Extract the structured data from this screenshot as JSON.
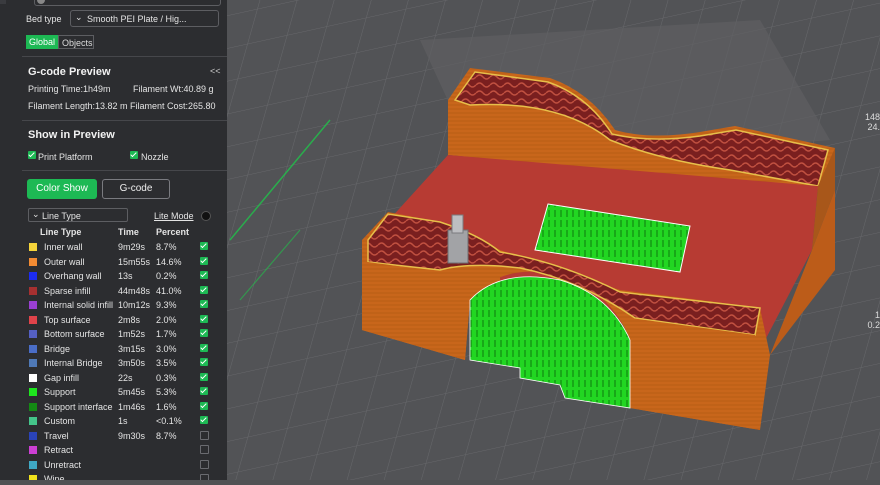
{
  "bed_type": {
    "label": "Bed type",
    "value": "Smooth PEI Plate / Hig..."
  },
  "tabs": {
    "global": "Global",
    "objects": "Objects"
  },
  "gcode_preview": {
    "title": "G-code Preview",
    "collapse": "<<",
    "printing_time": "Printing Time:1h49m",
    "filament_wt": "Filament Wt:40.89 g",
    "filament_length": "Filament Length:13.82 m",
    "filament_cost": "Filament Cost:265.80"
  },
  "show_in_preview": {
    "title": "Show in Preview",
    "print_platform": "Print Platform",
    "nozzle": "Nozzle"
  },
  "buttons": {
    "color_show": "Color Show",
    "gcode": "G-code"
  },
  "line_type_select": {
    "value": "Line Type",
    "lite_mode": "Lite Mode"
  },
  "table": {
    "headers": [
      "Line Type",
      "Time",
      "Percent"
    ],
    "rows": [
      {
        "label": "Inner wall",
        "time": "9m29s",
        "percent": "8.7%",
        "color": "#f5d43a",
        "checked": true
      },
      {
        "label": "Outer wall",
        "time": "15m55s",
        "percent": "14.6%",
        "color": "#f28b33",
        "checked": true
      },
      {
        "label": "Overhang wall",
        "time": "13s",
        "percent": "0.2%",
        "color": "#1c2cf0",
        "checked": true
      },
      {
        "label": "Sparse infill",
        "time": "44m48s",
        "percent": "41.0%",
        "color": "#a63030",
        "checked": true
      },
      {
        "label": "Internal solid infill",
        "time": "10m12s",
        "percent": "9.3%",
        "color": "#9a3fd1",
        "checked": true
      },
      {
        "label": "Top surface",
        "time": "2m8s",
        "percent": "2.0%",
        "color": "#e0434a",
        "checked": true
      },
      {
        "label": "Bottom surface",
        "time": "1m52s",
        "percent": "1.7%",
        "color": "#5560c4",
        "checked": true
      },
      {
        "label": "Bridge",
        "time": "3m15s",
        "percent": "3.0%",
        "color": "#4a6dc7",
        "checked": true
      },
      {
        "label": "Internal Bridge",
        "time": "3m50s",
        "percent": "3.5%",
        "color": "#4f79b7",
        "checked": true
      },
      {
        "label": "Gap infill",
        "time": "22s",
        "percent": "0.3%",
        "color": "#ffffff",
        "checked": true
      },
      {
        "label": "Support",
        "time": "5m45s",
        "percent": "5.3%",
        "color": "#1ee61e",
        "checked": true
      },
      {
        "label": "Support interface",
        "time": "1m46s",
        "percent": "1.6%",
        "color": "#148a14",
        "checked": true
      },
      {
        "label": "Custom",
        "time": "1s",
        "percent": "<0.1%",
        "color": "#44c48a",
        "checked": true
      },
      {
        "label": "Travel",
        "time": "9m30s",
        "percent": "8.7%",
        "color": "#2a43b8",
        "checked": false
      },
      {
        "label": "Retract",
        "time": "",
        "percent": "",
        "color": "#cc3fd4",
        "checked": false
      },
      {
        "label": "Unretract",
        "time": "",
        "percent": "",
        "color": "#3fa8c4",
        "checked": false
      },
      {
        "label": "Wipe",
        "time": "",
        "percent": "",
        "color": "#f0e21c",
        "checked": false
      }
    ]
  },
  "viewport": {
    "slider_top_value": "148",
    "slider_top_value2": "24.",
    "slider_low_value": "1",
    "slider_low_value2": "0.2"
  }
}
